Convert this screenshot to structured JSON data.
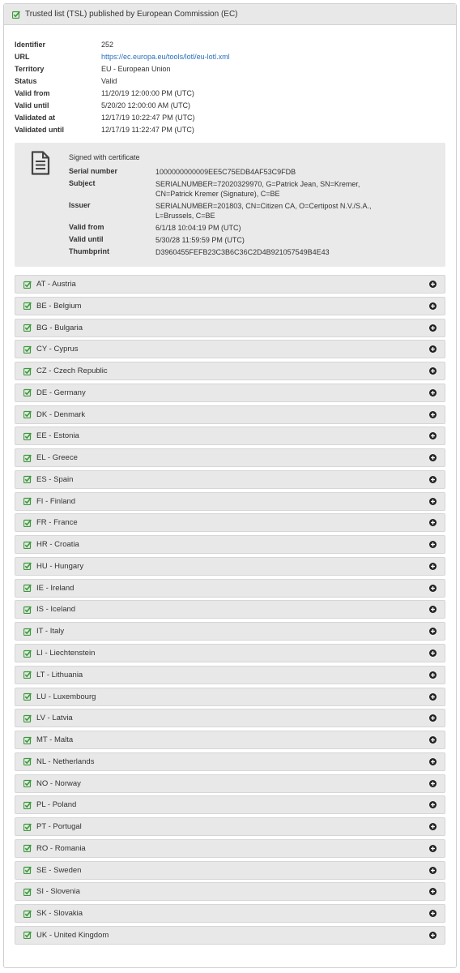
{
  "panel": {
    "title": "Trusted list (TSL) published by European Commission (EC)"
  },
  "details": [
    {
      "label": "Identifier",
      "value": "252"
    },
    {
      "label": "URL",
      "value": "https://ec.europa.eu/tools/lotl/eu-lotl.xml"
    },
    {
      "label": "Territory",
      "value": "EU - European Union"
    },
    {
      "label": "Status",
      "value": "Valid"
    },
    {
      "label": "Valid from",
      "value": "11/20/19 12:00:00 PM (UTC)"
    },
    {
      "label": "Valid until",
      "value": "5/20/20 12:00:00 AM (UTC)"
    },
    {
      "label": "Validated at",
      "value": "12/17/19 10:22:47 PM (UTC)"
    },
    {
      "label": "Validated until",
      "value": "12/17/19 11:22:47 PM (UTC)"
    }
  ],
  "certificate": {
    "heading": "Signed with certificate",
    "icon": "document-icon",
    "rows": [
      {
        "label": "Serial number",
        "value": "1000000000009EE5C75EDB4AF53C9FDB"
      },
      {
        "label": "Subject",
        "value": "SERIALNUMBER=72020329970, G=Patrick Jean, SN=Kremer, CN=Patrick Kremer (Signature), C=BE"
      },
      {
        "label": "Issuer",
        "value": "SERIALNUMBER=201803, CN=Citizen CA, O=Certipost N.V./S.A., L=Brussels, C=BE"
      },
      {
        "label": "Valid from",
        "value": "6/1/18 10:04:19 PM (UTC)"
      },
      {
        "label": "Valid until",
        "value": "5/30/28 11:59:59 PM (UTC)"
      },
      {
        "label": "Thumbprint",
        "value": "D3960455FEFB23C3B6C36C2D4B921057549B4E43"
      }
    ]
  },
  "colors": {
    "check": "#3a9a3a",
    "link": "#2a6ebb",
    "header_bg": "#e8e8e8",
    "item_bg": "#e8e8e8",
    "cert_bg": "#eaeaea"
  },
  "countries": [
    "AT - Austria",
    "BE - Belgium",
    "BG - Bulgaria",
    "CY - Cyprus",
    "CZ - Czech Republic",
    "DE - Germany",
    "DK - Denmark",
    "EE - Estonia",
    "EL - Greece",
    "ES - Spain",
    "FI - Finland",
    "FR - France",
    "HR - Croatia",
    "HU - Hungary",
    "IE - Ireland",
    "IS - Iceland",
    "IT - Italy",
    "LI - Liechtenstein",
    "LT - Lithuania",
    "LU - Luxembourg",
    "LV - Latvia",
    "MT - Malta",
    "NL - Netherlands",
    "NO - Norway",
    "PL - Poland",
    "PT - Portugal",
    "RO - Romania",
    "SE - Sweden",
    "SI - Slovenia",
    "SK - Slovakia",
    "UK - United Kingdom"
  ]
}
